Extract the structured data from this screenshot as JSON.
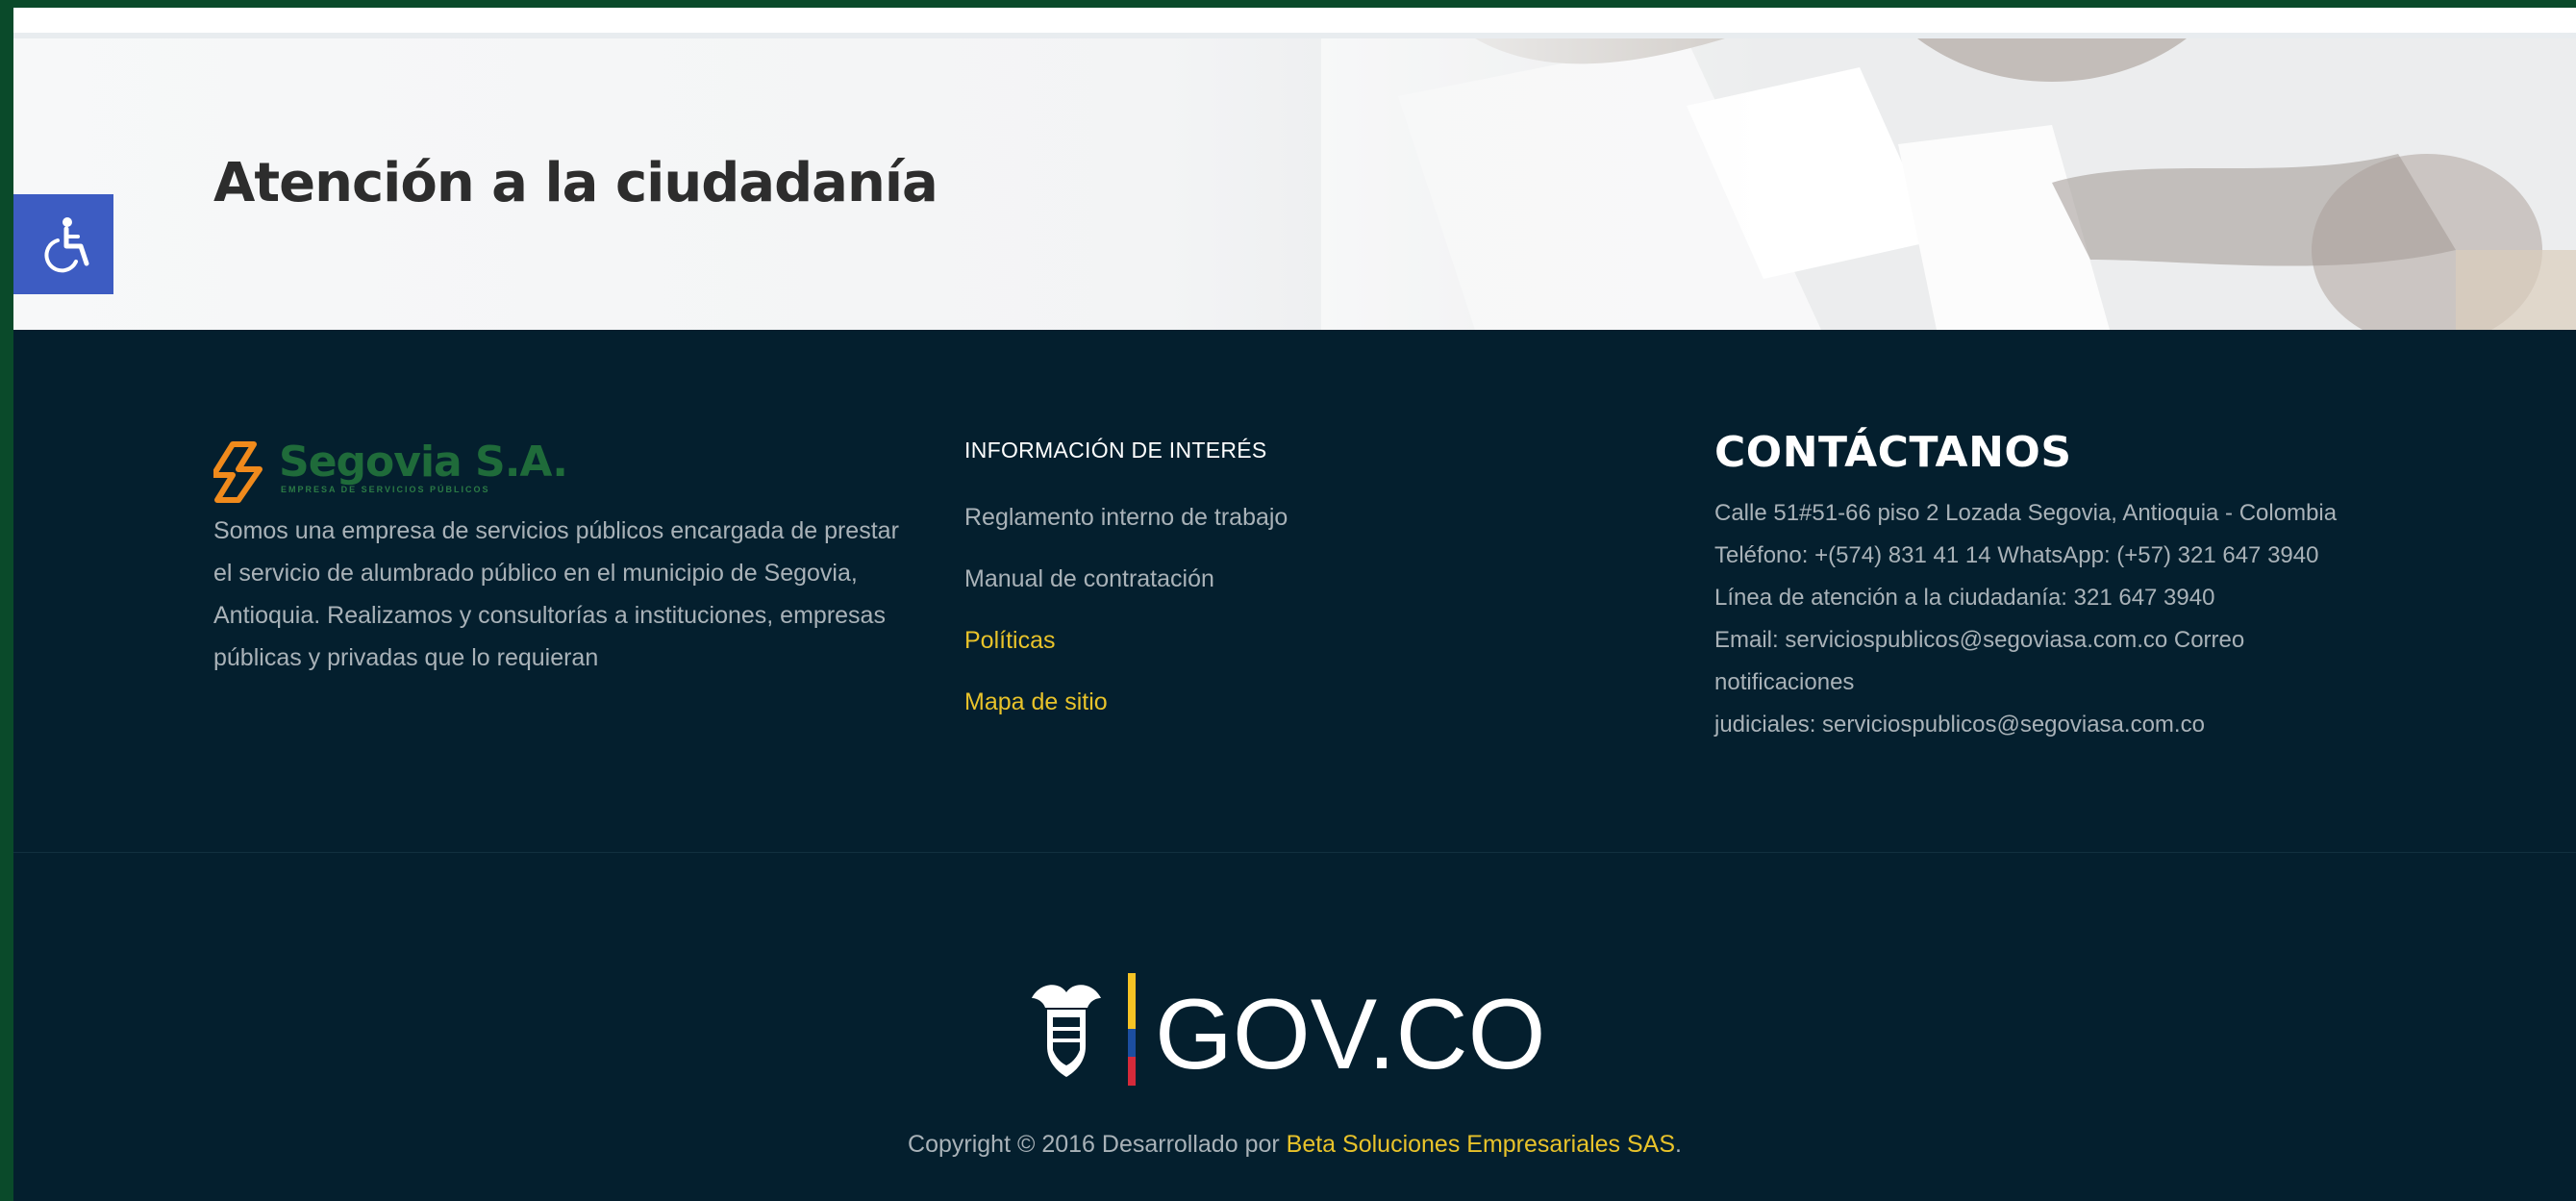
{
  "hero": {
    "title": "Atención a la ciudadanía"
  },
  "accessibility": {
    "icon": "wheelchair-icon",
    "color": "#3d5cc2"
  },
  "footer": {
    "logo": {
      "name": "Segovia S.A.",
      "tagline": "EMPRESA DE SERVICIOS PÚBLICOS"
    },
    "about": "Somos una empresa de servicios públicos encargada de prestar el servicio de alumbrado público en el municipio de Segovia, Antioquia. Realizamos y consultorías a instituciones, empresas públicas y privadas que lo requieran",
    "info": {
      "heading": "INFORMACIÓN DE INTERÉS",
      "links": [
        {
          "label": "Reglamento interno de trabajo"
        },
        {
          "label": "Manual de contratación"
        },
        {
          "label": "Políticas"
        },
        {
          "label": "Mapa de sitio"
        }
      ]
    },
    "contact": {
      "heading": "CONTÁCTANOS",
      "lines": [
        "Calle 51#51-66 piso 2 Lozada Segovia, Antioquia - Colombia",
        "Teléfono: +(574) 831 41 14 WhatsApp: (+57) 321 647 3940",
        "Línea de atención a la ciudadanía: 321 647 3940",
        "Email: serviciospublicos@segoviasa.com.co Correo",
        "notificaciones",
        "judiciales: serviciospublicos@segoviasa.com.co"
      ]
    },
    "govco": {
      "label": "GOV.CO"
    },
    "copyright": {
      "prefix": "Copyright © 2016 Desarrollado por ",
      "company": "Beta Soluciones Empresariales SAS",
      "suffix": "."
    }
  },
  "colors": {
    "footer_bg": "#041f2e",
    "accent_yellow": "#e9c32a",
    "frame_green": "#0a4a2a",
    "logo_orange": "#f08a1c",
    "logo_green": "#1f6b3a"
  }
}
